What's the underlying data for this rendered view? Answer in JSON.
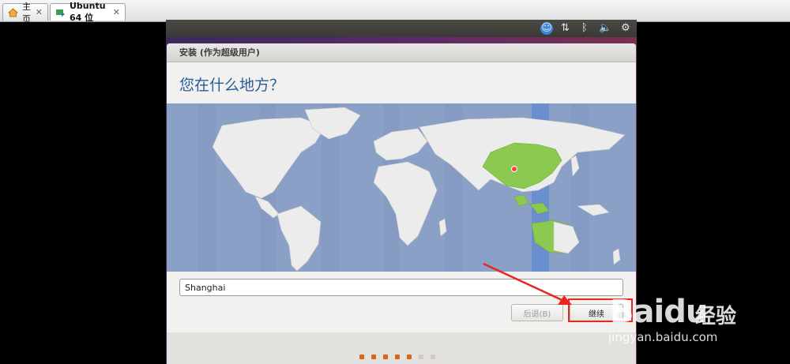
{
  "tabs": [
    {
      "label": "主页",
      "icon": "home-icon"
    },
    {
      "label": "Ubuntu 64 位",
      "icon": "vm-icon"
    }
  ],
  "panel": {
    "icons": [
      "accessibility-icon",
      "network-icon",
      "bluetooth-icon",
      "volume-icon",
      "gear-icon"
    ]
  },
  "installer": {
    "window_title": "安装 (作为超级用户)",
    "heading": "您在什么地方？",
    "city_value": "Shanghai",
    "back_label": "后退(B)",
    "continue_label": "继续",
    "progress_total": 7,
    "progress_done": 5
  },
  "watermark": {
    "brand": "Baidu",
    "brand_cn": "经验",
    "url": "jingyan.baidu.com"
  },
  "colors": {
    "map_ocean": "#8ba0c6",
    "land": "#ececec",
    "selected_region": "#8cc950",
    "timezone_band": "#6a8fcf",
    "accent": "#e0641c",
    "annotation_red": "#e8271f"
  }
}
